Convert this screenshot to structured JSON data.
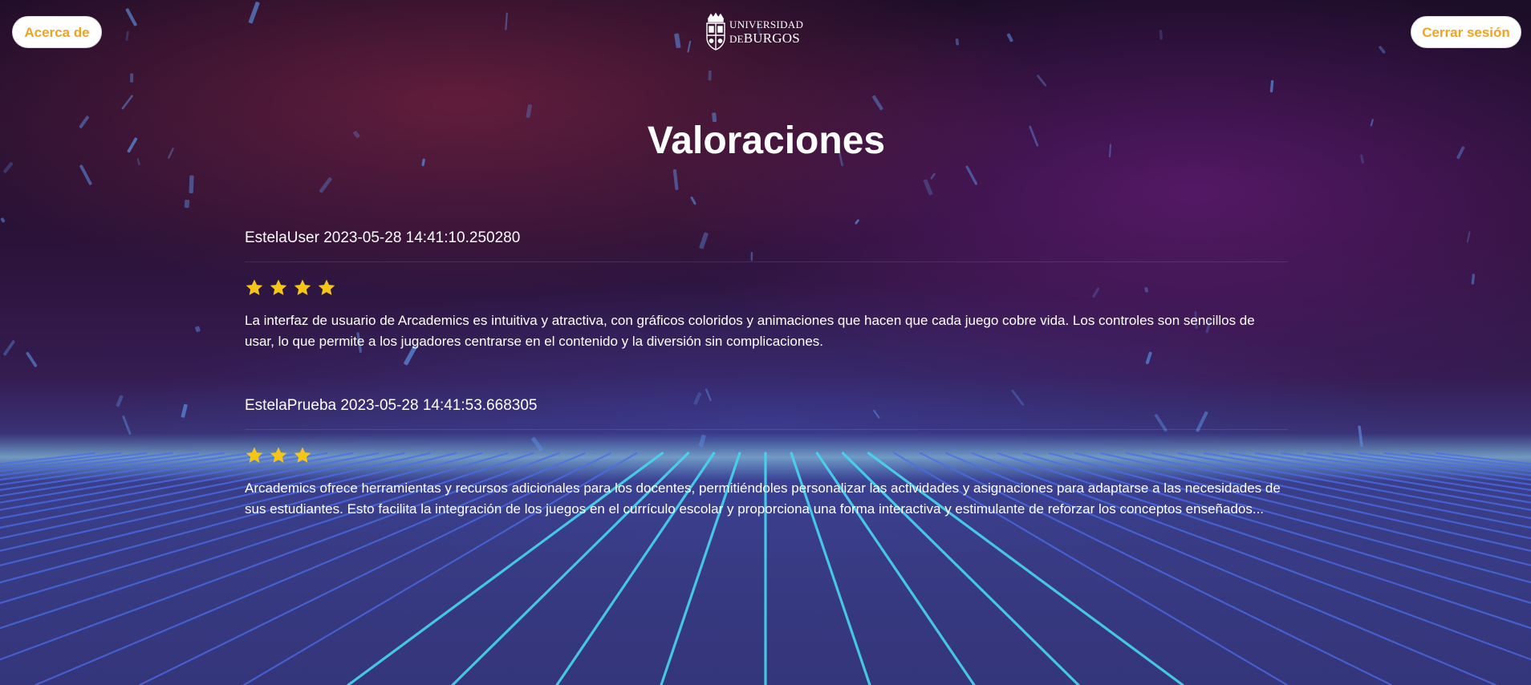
{
  "header": {
    "about_label": "Acerca de",
    "logout_label": "Cerrar sesión",
    "logo": {
      "line1": "UNIVERSIDAD",
      "line2_prefix": "DE",
      "line2_main": "BURGOS"
    }
  },
  "page": {
    "title": "Valoraciones"
  },
  "reviews": [
    {
      "header": "EstelaUser 2023-05-28 14:41:10.250280",
      "rating": 4,
      "text": "La interfaz de usuario de Arcademics es intuitiva y atractiva, con gráficos coloridos y animaciones que hacen que cada juego cobre vida. Los controles son sencillos de usar, lo que permite a los jugadores centrarse en el contenido y la diversión sin complicaciones."
    },
    {
      "header": "EstelaPrueba 2023-05-28 14:41:53.668305",
      "rating": 3,
      "text": "Arcademics ofrece herramientas y recursos adicionales para los docentes, permitiéndoles personalizar las actividades y asignaciones para adaptarse a las necesidades de sus estudiantes. Esto facilita la integración de los juegos en el currículo escolar y proporciona una forma interactiva y estimulante de reforzar los conceptos enseñados..."
    }
  ],
  "colors": {
    "accent": "#f0a420",
    "star": "#f5c518",
    "grid_line": "#47d6f0"
  },
  "icons": {
    "star": "star-icon",
    "logo": "university-crest-icon"
  }
}
